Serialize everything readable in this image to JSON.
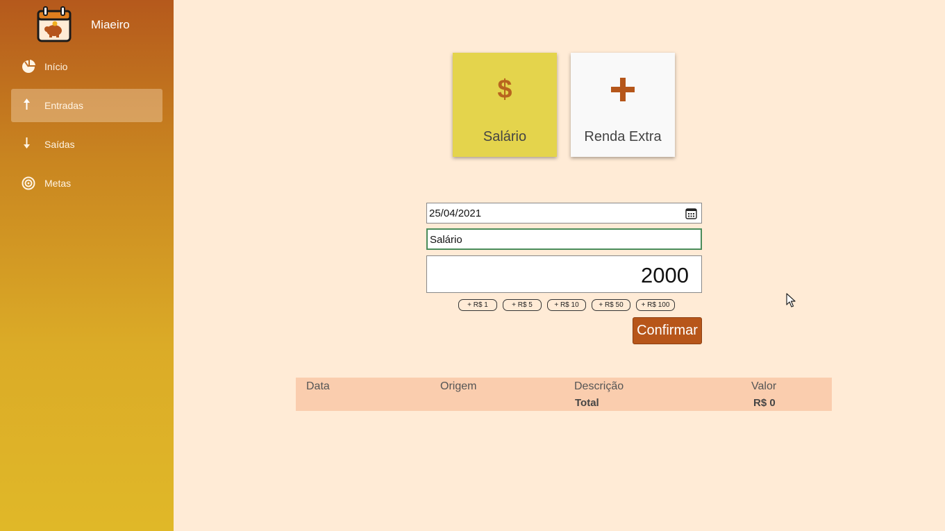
{
  "app": {
    "name": "Miaeiro",
    "logo_icon": "piggy-bank-calendar-icon"
  },
  "sidebar": {
    "items": [
      {
        "label": "Início",
        "icon": "pie-chart-icon",
        "active": false
      },
      {
        "label": "Entradas",
        "icon": "arrow-up-icon",
        "active": true
      },
      {
        "label": "Saídas",
        "icon": "arrow-down-icon",
        "active": false
      },
      {
        "label": "Metas",
        "icon": "target-icon",
        "active": false
      }
    ]
  },
  "categories": [
    {
      "label": "Salário",
      "symbol": "$",
      "icon": "dollar-icon",
      "selected": true,
      "color": "#e4d44c"
    },
    {
      "label": "Renda Extra",
      "symbol": "+",
      "icon": "plus-icon",
      "selected": false,
      "color": "#f9f9f9"
    }
  ],
  "form": {
    "date": "25/04/2021",
    "description": "Salário",
    "value": "2000",
    "quick_add": [
      "+ R$ 1",
      "+ R$ 5",
      "+ R$ 10",
      "+ R$ 50",
      "+ R$ 100"
    ],
    "confirm_label": "Confirmar"
  },
  "table": {
    "headers": [
      "Data",
      "Origem",
      "Descrição",
      "Valor"
    ],
    "rows": [],
    "total_label": "Total",
    "total_value": "R$ 0"
  },
  "colors": {
    "accent": "#b7561a",
    "background": "#ffebd6",
    "table_bg": "#facdae"
  }
}
